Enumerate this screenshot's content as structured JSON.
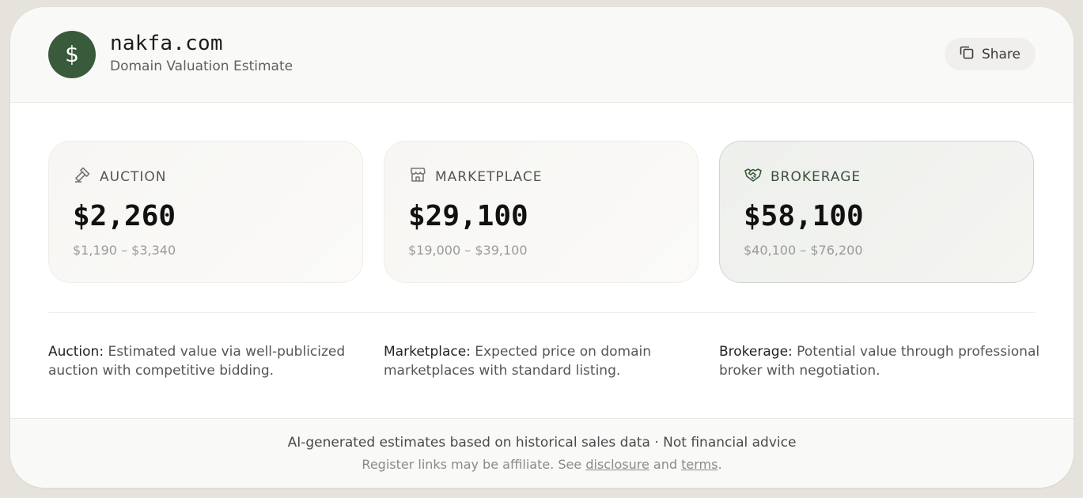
{
  "header": {
    "domain": "nakfa.com",
    "subtitle": "Domain Valuation Estimate",
    "logo_icon": "dollar-sign-icon",
    "share_label": "Share",
    "share_icon": "copy-icon"
  },
  "colors": {
    "brand": "#3a5a3c",
    "background": "#e6e3dd"
  },
  "tiers": [
    {
      "icon": "gavel-icon",
      "label": "AUCTION",
      "value": "$2,260",
      "range": "$1,190 – $3,340"
    },
    {
      "icon": "storefront-icon",
      "label": "MARKETPLACE",
      "value": "$29,100",
      "range": "$19,000 – $39,100"
    },
    {
      "icon": "handshake-icon",
      "label": "BROKERAGE",
      "value": "$58,100",
      "range": "$40,100 – $76,200"
    }
  ],
  "descriptions": [
    {
      "term": "Auction:",
      "text": " Estimated value via well-publicized auction with competitive bidding."
    },
    {
      "term": "Marketplace:",
      "text": " Expected price on domain marketplaces with standard listing."
    },
    {
      "term": "Brokerage:",
      "text": " Potential value through professional broker with negotiation."
    }
  ],
  "footer": {
    "line1": "AI-generated estimates based on historical sales data · Not financial advice",
    "line2_prefix": "Register links may be affiliate. See ",
    "disclosure": "disclosure",
    "and": " and ",
    "terms": "terms",
    "period": "."
  }
}
